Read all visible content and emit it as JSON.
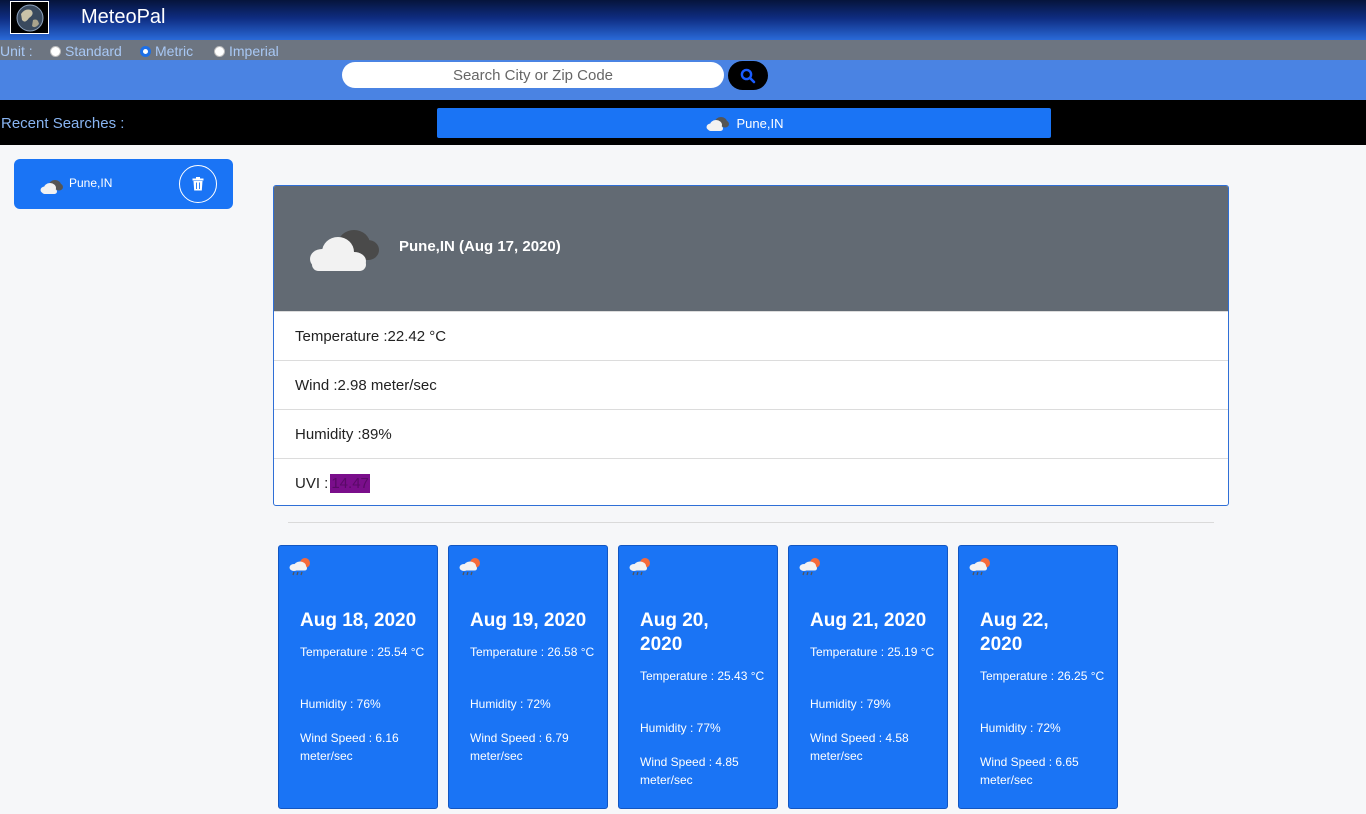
{
  "header": {
    "brand": "MeteoPal",
    "logo_icon": "globe-icon"
  },
  "units": {
    "label": "Unit :",
    "options": [
      {
        "label": "Standard",
        "checked": false
      },
      {
        "label": "Metric",
        "checked": true
      },
      {
        "label": "Imperial",
        "checked": false
      }
    ]
  },
  "search": {
    "placeholder": "Search City or Zip Code",
    "value": "",
    "button_icon": "search-icon"
  },
  "recent": {
    "label": "Recent Searches :",
    "items": [
      {
        "label": "Pune,IN",
        "icon": "cloud-icon"
      }
    ]
  },
  "sidebar": {
    "items": [
      {
        "label": "Pune,IN",
        "icon": "cloud-icon",
        "action_icon": "trash-icon"
      }
    ]
  },
  "current": {
    "title": "Pune,IN (Aug 17, 2020)",
    "icon": "cloud-icon",
    "rows": {
      "temperature": "Temperature :22.42 °C",
      "wind": "Wind :2.98 meter/sec",
      "humidity": "Humidity :89%",
      "uvi_label": "UVI :",
      "uvi_value": "14.47"
    },
    "uvi_color": "#7a0e8b"
  },
  "forecast": [
    {
      "date": "Aug 18, 2020",
      "temperature": "Temperature : 25.54 °C",
      "humidity": "Humidity : 76%",
      "wind": "Wind Speed : 6.16 meter/sec",
      "icon": "rain-sun-icon"
    },
    {
      "date": "Aug 19, 2020",
      "temperature": "Temperature : 26.58 °C",
      "humidity": "Humidity : 72%",
      "wind": "Wind Speed : 6.79 meter/sec",
      "icon": "rain-sun-icon"
    },
    {
      "date": "Aug 20, 2020",
      "temperature": "Temperature : 25.43 °C",
      "humidity": "Humidity : 77%",
      "wind": "Wind Speed : 4.85 meter/sec",
      "icon": "rain-sun-icon"
    },
    {
      "date": "Aug 21, 2020",
      "temperature": "Temperature : 25.19 °C",
      "humidity": "Humidity : 79%",
      "wind": "Wind Speed : 4.58 meter/sec",
      "icon": "rain-sun-icon"
    },
    {
      "date": "Aug 22, 2020",
      "temperature": "Temperature : 26.25 °C",
      "humidity": "Humidity : 72%",
      "wind": "Wind Speed : 6.65 meter/sec",
      "icon": "rain-sun-icon"
    }
  ],
  "colors": {
    "primary": "#1a74f5",
    "card_header": "#626a73",
    "search_bar": "#4a83e3"
  }
}
